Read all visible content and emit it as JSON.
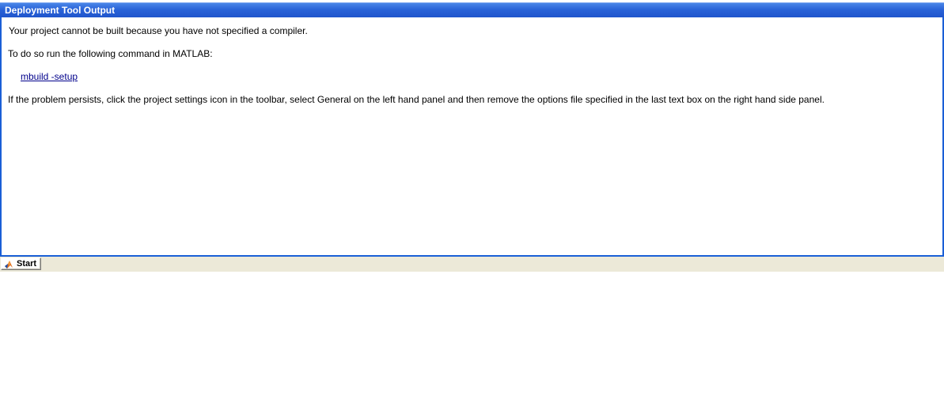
{
  "window": {
    "title": "Deployment Tool Output"
  },
  "output": {
    "line1": "Your project cannot be built because you have not specified a compiler.",
    "line2": "To do so run the following command in MATLAB:",
    "command_link": "mbuild -setup",
    "line4": "If the problem persists, click the project settings icon in the toolbar, select General on the left hand panel and then remove the options file specified in the last text box on the right hand side panel."
  },
  "taskbar": {
    "start_label": "Start",
    "start_icon": "matlab-logo-icon"
  },
  "colors": {
    "title_bar": "#2a63d8",
    "border": "#1a5fd6",
    "link": "#00008b",
    "status_bar": "#ece9d8"
  }
}
